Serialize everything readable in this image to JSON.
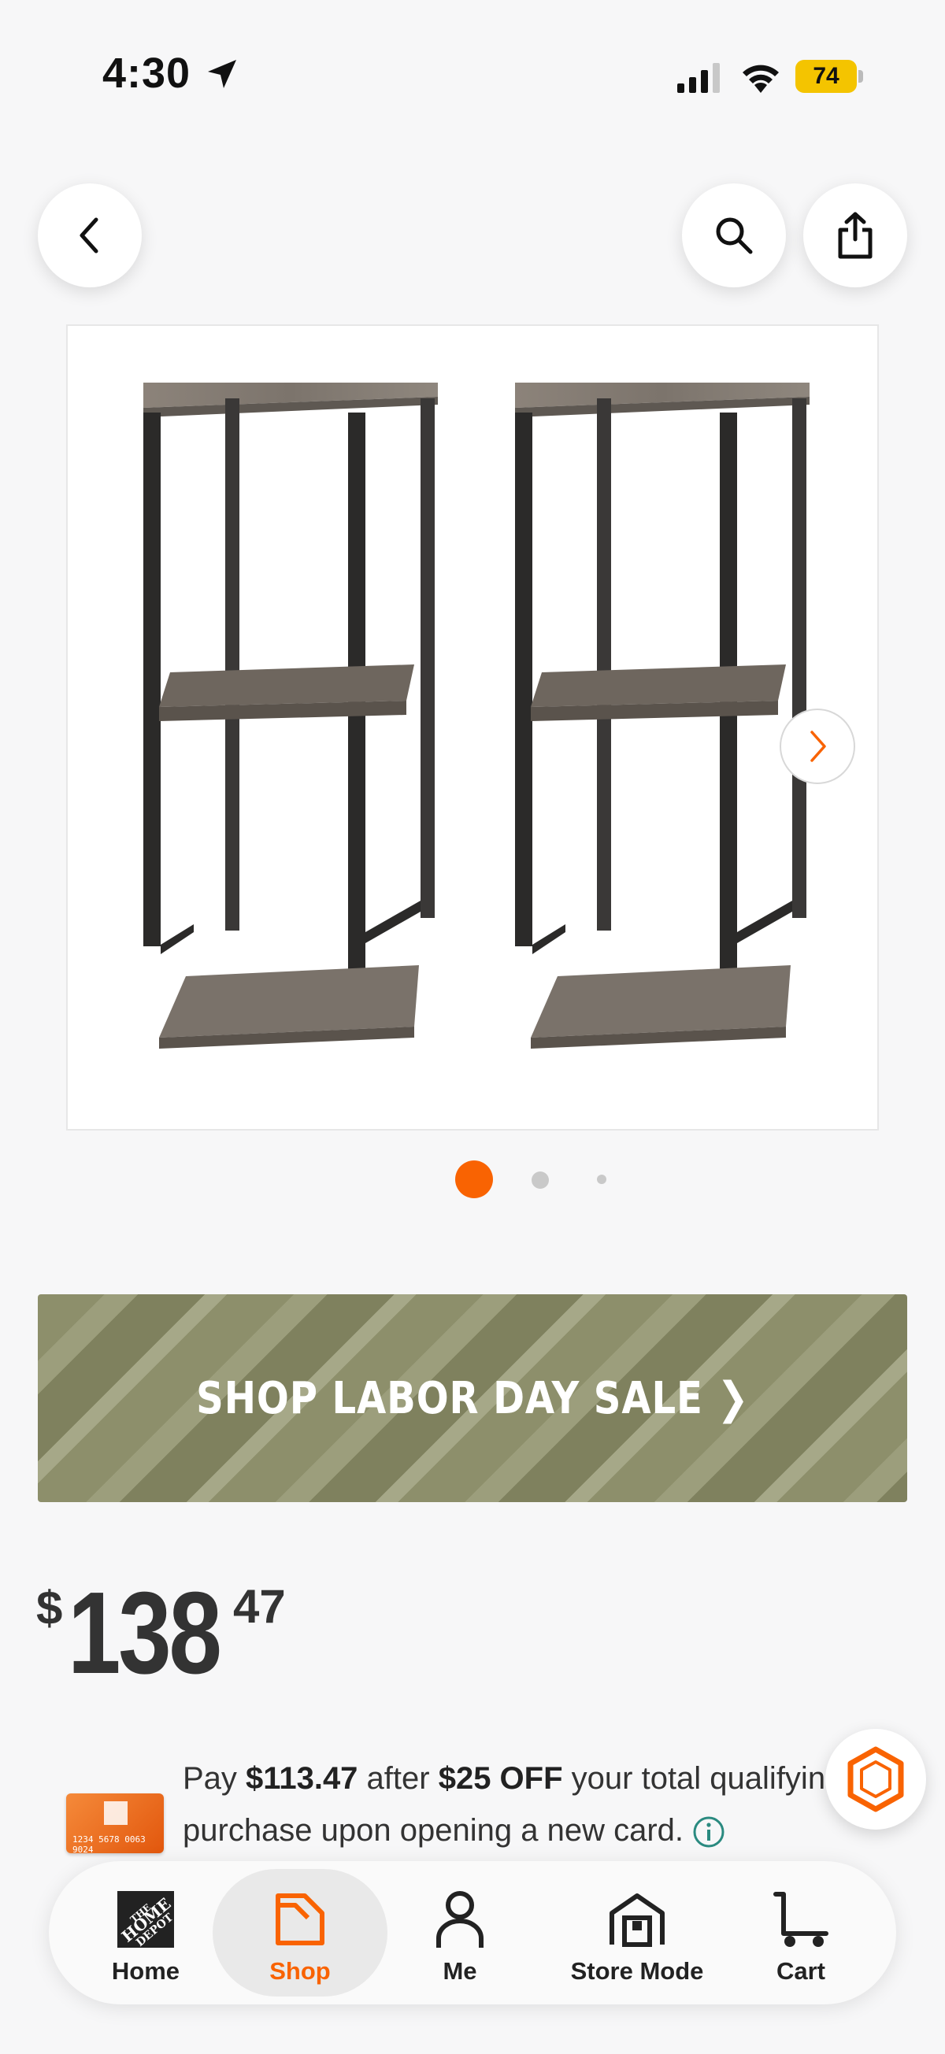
{
  "status_bar": {
    "time": "4:30",
    "battery": "74",
    "icons": [
      "location-arrow-icon",
      "cellular-signal-icon",
      "wifi-icon",
      "battery-icon"
    ]
  },
  "header": {
    "icons": [
      "chevron-left-icon",
      "search-icon",
      "share-icon"
    ]
  },
  "gallery": {
    "image_count": 3,
    "active_index": 1,
    "next_icon": "chevron-right-icon",
    "accent_color": "#f96302"
  },
  "banner": {
    "label": "SHOP LABOR DAY SALE ❯"
  },
  "price": {
    "currency": "$",
    "dollars": "138",
    "cents": "47"
  },
  "offer": {
    "text_1": "Pay ",
    "amount": "$113.47",
    "text_2": " after ",
    "discount": "$25 OFF",
    "text_3": " your total qualifying",
    "text_4": "purchase upon opening a new card.",
    "card_number": "1234 5678 0063 9024"
  },
  "bottom_nav": {
    "items": [
      {
        "label": "Home",
        "icon": "home-depot-logo-icon"
      },
      {
        "label": "Shop",
        "icon": "shop-tag-icon",
        "active": true
      },
      {
        "label": "Me",
        "icon": "person-icon"
      },
      {
        "label": "Store Mode",
        "icon": "store-icon"
      },
      {
        "label": "Cart",
        "icon": "cart-icon"
      }
    ],
    "active_color": "#f96302"
  }
}
